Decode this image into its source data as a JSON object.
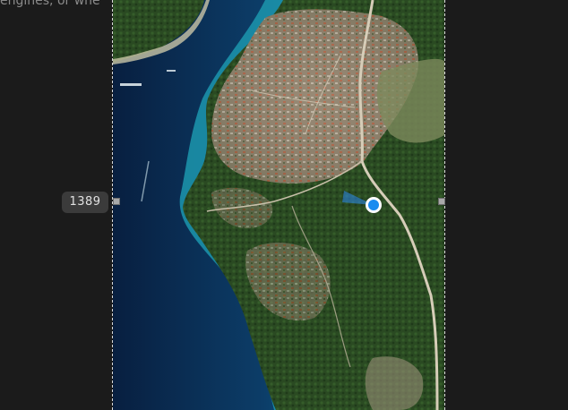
{
  "background_text": "engines, or whe",
  "zoom": {
    "value": "1389"
  },
  "colors": {
    "deep_sea": "#0a2547",
    "mid_sea": "#0e4d78",
    "shallow_sea": "#1e9bb3",
    "land_green": "#2c4d24",
    "urban": "#9a8d7c",
    "location_dot": "#1a8cf0"
  },
  "icons": {
    "location": "location-dot-icon",
    "heading": "heading-cone-icon"
  }
}
